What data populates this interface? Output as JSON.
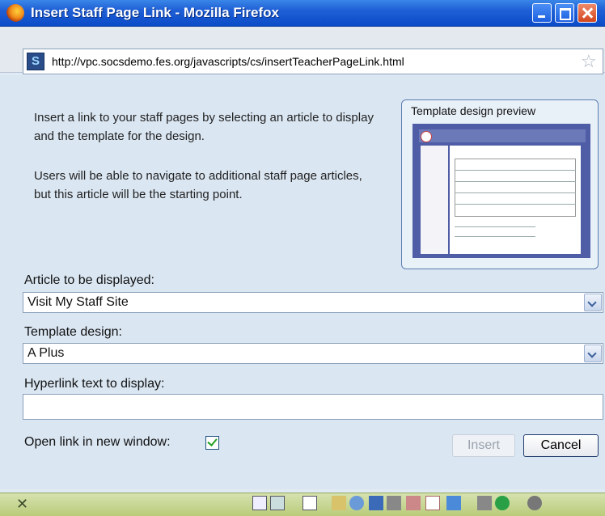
{
  "window": {
    "title": "Insert Staff Page Link - Mozilla Firefox",
    "url": "http://vpc.socsdemo.fes.org/javascripts/cs/insertTeacherPageLink.html"
  },
  "dialog": {
    "intro1": "Insert a link to your staff pages by selecting an article to display and the template for the design.",
    "intro2": "Users will be able to navigate to additional staff page articles, but this article will be the starting point.",
    "preview_label": "Template design preview",
    "article_label": "Article to be displayed:",
    "article_value": "Visit My Staff Site",
    "template_label": "Template design:",
    "template_value": "A Plus",
    "hyperlink_label": "Hyperlink text to display:",
    "hyperlink_value": "",
    "open_new_label": "Open link in new window:",
    "open_new_checked": true,
    "insert_label": "Insert",
    "cancel_label": "Cancel"
  },
  "icons": {
    "browser": "firefox-icon",
    "site": "site-favicon",
    "bookmark": "star-icon",
    "status_close": "close-icon"
  },
  "colors": {
    "titlebar": "#1f5fd6",
    "content_bg": "#dae6f2",
    "statusbar": "#c3d48a",
    "preview_bg": "#4f5da6"
  }
}
